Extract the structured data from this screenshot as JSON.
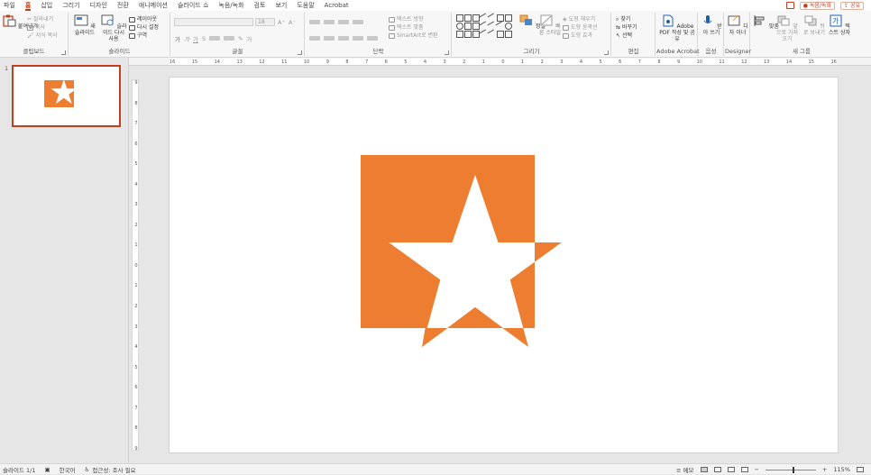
{
  "tabs": [
    "파일",
    "홈",
    "삽입",
    "그리기",
    "디자인",
    "전환",
    "애니메이션",
    "슬라이드 쇼",
    "녹음/녹화",
    "검토",
    "보기",
    "도움말",
    "Acrobat"
  ],
  "active_tab": 1,
  "top_right": {
    "record": "녹음/녹화",
    "share": "공유"
  },
  "ribbon": {
    "clipboard": {
      "label": "클립보드",
      "paste": "붙여넣기",
      "cut": "잘라내기",
      "copy": "복사",
      "format_painter": "서식 복사"
    },
    "slides": {
      "label": "슬라이드",
      "new_slide": "새 슬라이드",
      "reuse": "슬라이드 다시 사용",
      "layout": "레이아웃",
      "reset": "다시 설정",
      "section": "구역"
    },
    "font": {
      "label": "글꼴",
      "size": "18"
    },
    "paragraph": {
      "label": "단락",
      "text_direction": "텍스트 방향",
      "align_text": "텍스트 맞춤",
      "smartart": "SmartArt로 변환"
    },
    "drawing": {
      "label": "그리기",
      "arrange": "정렬",
      "quick_styles": "빠른 스타일",
      "fill": "도형 채우기",
      "outline": "도형 윤곽선",
      "effects": "도형 효과"
    },
    "editing": {
      "label": "편집",
      "find": "찾기",
      "replace": "바꾸기",
      "select": "선택"
    },
    "acrobat": {
      "label": "Adobe Acrobat",
      "create": "Adobe PDF 작성 및 공유"
    },
    "voice": {
      "label": "음성",
      "dictate": "받아 쓰기"
    },
    "designer": {
      "label": "Designer",
      "designer_btn": "디자 이너"
    },
    "new_group": {
      "label": "새 그룹",
      "align": "맞춤",
      "bring_front": "앞으로 가져오기",
      "send_back": "뒤로 보내기",
      "textbox": "텍스트 상자"
    }
  },
  "ruler_h_ticks": [
    "16",
    "15",
    "14",
    "13",
    "12",
    "11",
    "10",
    "9",
    "8",
    "7",
    "6",
    "5",
    "4",
    "3",
    "2",
    "1",
    "0",
    "1",
    "2",
    "3",
    "4",
    "5",
    "6",
    "7",
    "8",
    "9",
    "10",
    "11",
    "12",
    "13",
    "14",
    "15",
    "16"
  ],
  "ruler_v_ticks": [
    "9",
    "8",
    "7",
    "6",
    "5",
    "4",
    "3",
    "2",
    "1",
    "0",
    "1",
    "2",
    "3",
    "4",
    "5",
    "6",
    "7",
    "8",
    "9"
  ],
  "thumbnail": {
    "number": "1"
  },
  "slide": {
    "shape_color": "#ed7d31"
  },
  "status": {
    "slide_counter": "슬라이드 1/1",
    "language": "한국어",
    "accessibility": "접근성: 조사 필요",
    "notes": "메모",
    "zoom": "115%"
  }
}
